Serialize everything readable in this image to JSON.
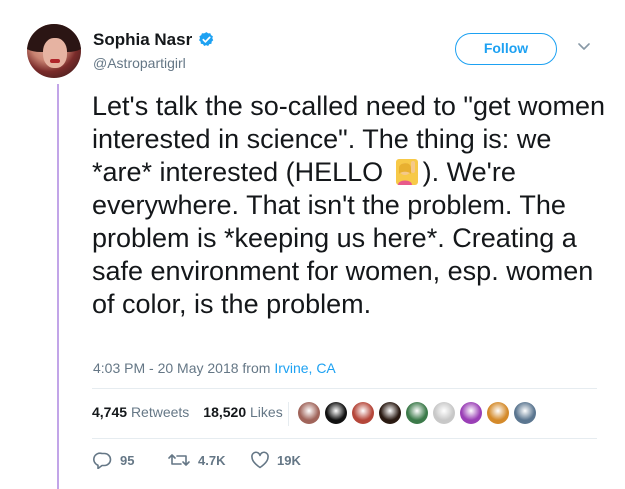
{
  "author": {
    "name": "Sophia Nasr",
    "handle": "@Astropartigirl"
  },
  "follow_label": "Follow",
  "tweet": {
    "text_before_emoji": "Let's talk the so-called need to \"get women interested in science\". The thing is: we *are* interested (HELLO",
    "emoji_name": "raising-hand-woman-emoji",
    "text_after_emoji": "). We're everywhere. That isn't the problem. The problem is *keeping us here*. Creating a safe environment for women, esp. women of color, is the problem."
  },
  "meta": {
    "timestamp": "4:03 PM - 20 May 2018",
    "from_label": " from ",
    "location": "Irvine, CA"
  },
  "stats": {
    "retweets_count": "4,745",
    "retweets_label": "Retweets",
    "likes_count": "18,520",
    "likes_label": "Likes"
  },
  "liker_avatars": [
    {
      "color": "#a0645a"
    },
    {
      "color": "#111111"
    },
    {
      "color": "#b5473a"
    },
    {
      "color": "#2a1a12"
    },
    {
      "color": "#3c7a4a"
    },
    {
      "color": "#c8c8c8"
    },
    {
      "color": "#9a3fb6"
    },
    {
      "color": "#d48a2a"
    },
    {
      "color": "#5b7690"
    }
  ],
  "actions": {
    "replies": "95",
    "retweets": "4.7K",
    "likes": "19K"
  },
  "colors": {
    "accent": "#1da1f2",
    "thread_line": "#c2a5e8",
    "secondary_text": "#657786"
  }
}
